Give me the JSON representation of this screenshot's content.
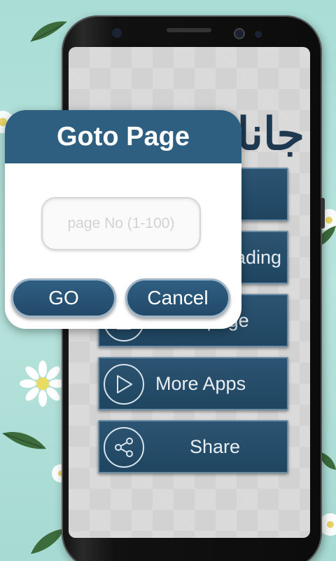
{
  "app": {
    "title_urdu": "جاناں تجھے"
  },
  "menu": [
    {
      "label": "",
      "icon": "book-icon"
    },
    {
      "label": "ading",
      "icon": "bookmark-icon"
    },
    {
      "label": "Go to page",
      "icon": "list-icon"
    },
    {
      "label": "More Apps",
      "icon": "play-icon"
    },
    {
      "label": "Share",
      "icon": "share-icon"
    }
  ],
  "dialog": {
    "title": "Goto Page",
    "input_placeholder": "page No (1-100)",
    "input_value": "",
    "go_label": "GO",
    "cancel_label": "Cancel"
  },
  "colors": {
    "accent": "#2e5e80",
    "background": "#b0e0d9"
  }
}
